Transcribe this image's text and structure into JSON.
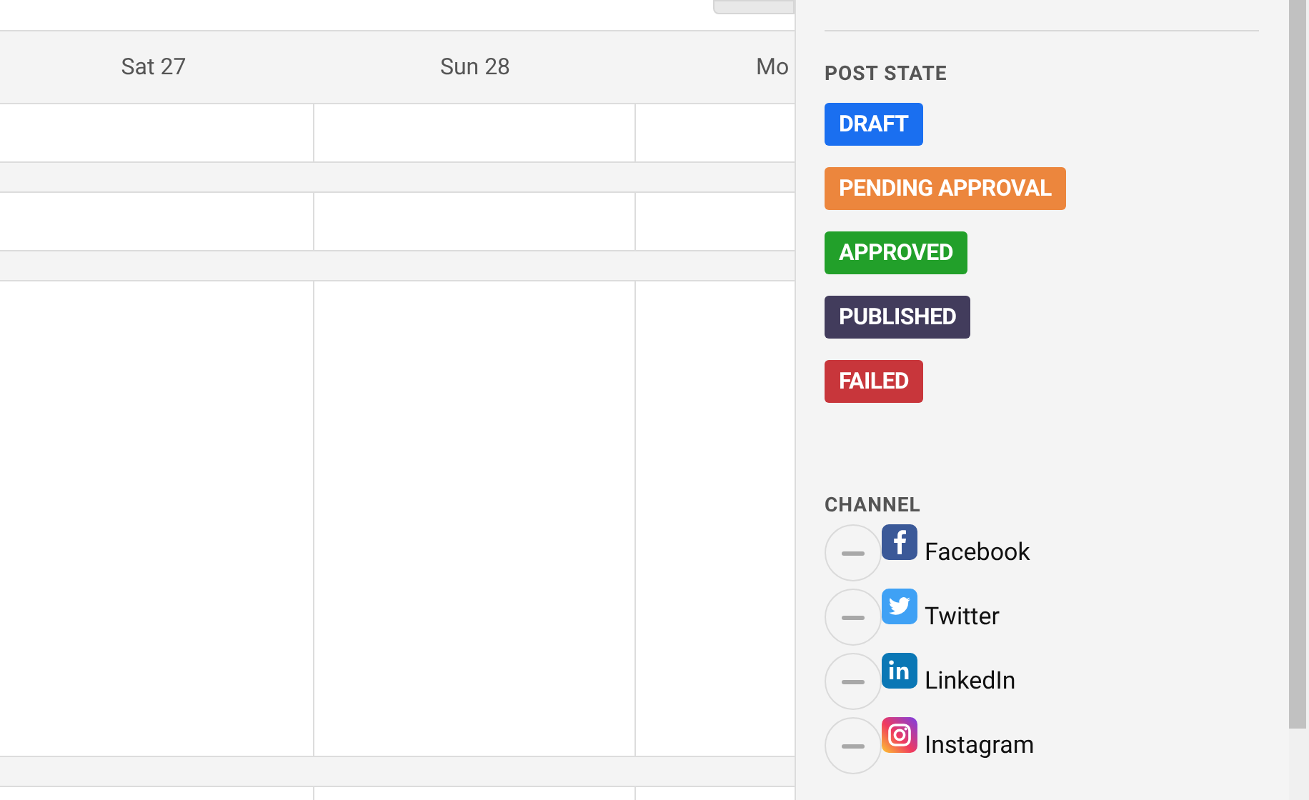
{
  "calendar": {
    "days": [
      "Sat 27",
      "Sun 28",
      "Mo"
    ]
  },
  "filters": {
    "post_state": {
      "title": "POST STATE",
      "states": [
        {
          "label": "DRAFT",
          "color": "#1a6ff0"
        },
        {
          "label": "PENDING APPROVAL",
          "color": "#ec863d"
        },
        {
          "label": "APPROVED",
          "color": "#22a02a"
        },
        {
          "label": "PUBLISHED",
          "color": "#423c5c"
        },
        {
          "label": "FAILED",
          "color": "#c8363b"
        }
      ]
    },
    "channel": {
      "title": "CHANNEL",
      "items": [
        {
          "label": "Facebook",
          "kind": "facebook",
          "selected": false
        },
        {
          "label": "Twitter",
          "kind": "twitter",
          "selected": false
        },
        {
          "label": "LinkedIn",
          "kind": "linkedin",
          "selected": false
        },
        {
          "label": "Instagram",
          "kind": "instagram",
          "selected": false
        }
      ]
    }
  }
}
